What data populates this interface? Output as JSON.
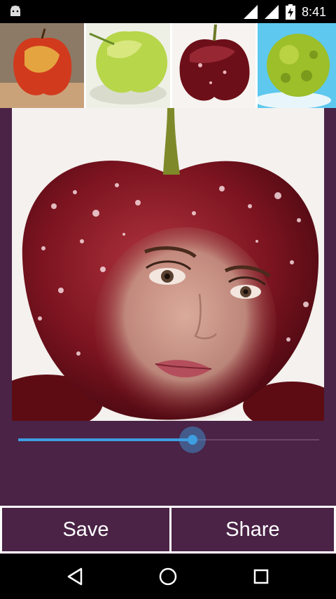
{
  "status_bar": {
    "time": "8:41",
    "icons": [
      "android-icon",
      "wifi-signal-icon",
      "cell-signal-icon",
      "battery-charging-icon"
    ]
  },
  "thumbnails": [
    {
      "name": "red-apple-thumbnail"
    },
    {
      "name": "green-apple-thumbnail"
    },
    {
      "name": "cherry-thumbnail"
    },
    {
      "name": "green-fruit-thumbnail"
    }
  ],
  "editor": {
    "blend_slider_value": 0.58
  },
  "actions": {
    "save_label": "Save",
    "share_label": "Share"
  },
  "nav_bar": {
    "icons": [
      "back-triangle-icon",
      "home-circle-icon",
      "recents-square-icon"
    ]
  },
  "colors": {
    "background": "#4a2346",
    "accent": "#3d9ee0",
    "button_border": "#ffffff"
  }
}
